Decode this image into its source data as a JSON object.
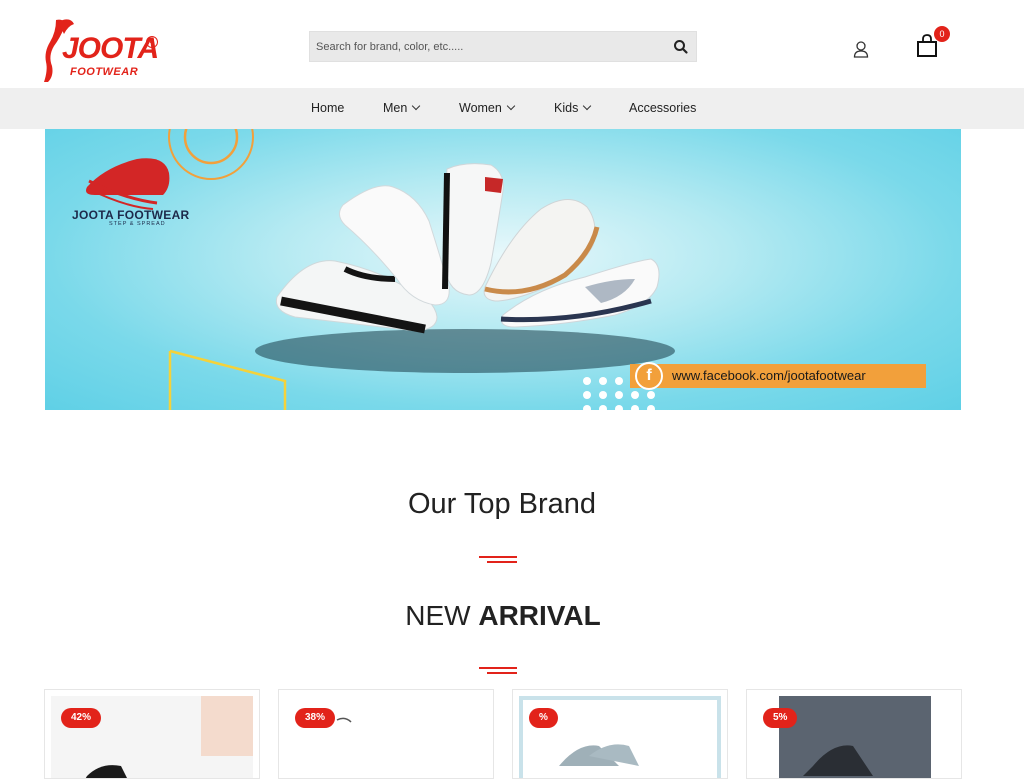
{
  "brand": {
    "logo_main": "JOOTA",
    "logo_sub": "FOOTWEAR",
    "registered": "R",
    "accent_color": "#e2231a"
  },
  "header": {
    "search_placeholder": "Search for brand, color, etc.....",
    "search_icon": "search-icon",
    "account_icon": "user-icon",
    "cart_icon": "shopping-bag-icon",
    "cart_count": "0"
  },
  "nav": {
    "items": [
      {
        "label": "Home",
        "has_dropdown": false
      },
      {
        "label": "Men",
        "has_dropdown": true
      },
      {
        "label": "Women",
        "has_dropdown": true
      },
      {
        "label": "Kids",
        "has_dropdown": true
      },
      {
        "label": "Accessories",
        "has_dropdown": false
      }
    ]
  },
  "banner": {
    "brand_name": "JOOTA FOOTWEAR",
    "tagline": "STEP & SPREAD",
    "facebook_icon": "f",
    "facebook_url": "www.facebook.com/jootafootwear"
  },
  "sections": {
    "top_brand_title": "Our Top Brand",
    "new_arrival_prefix": "NEW ",
    "new_arrival_bold": "ARRIVAL"
  },
  "products": [
    {
      "discount": "42%"
    },
    {
      "discount": "38%"
    },
    {
      "discount": "%"
    },
    {
      "discount": "5%"
    }
  ]
}
